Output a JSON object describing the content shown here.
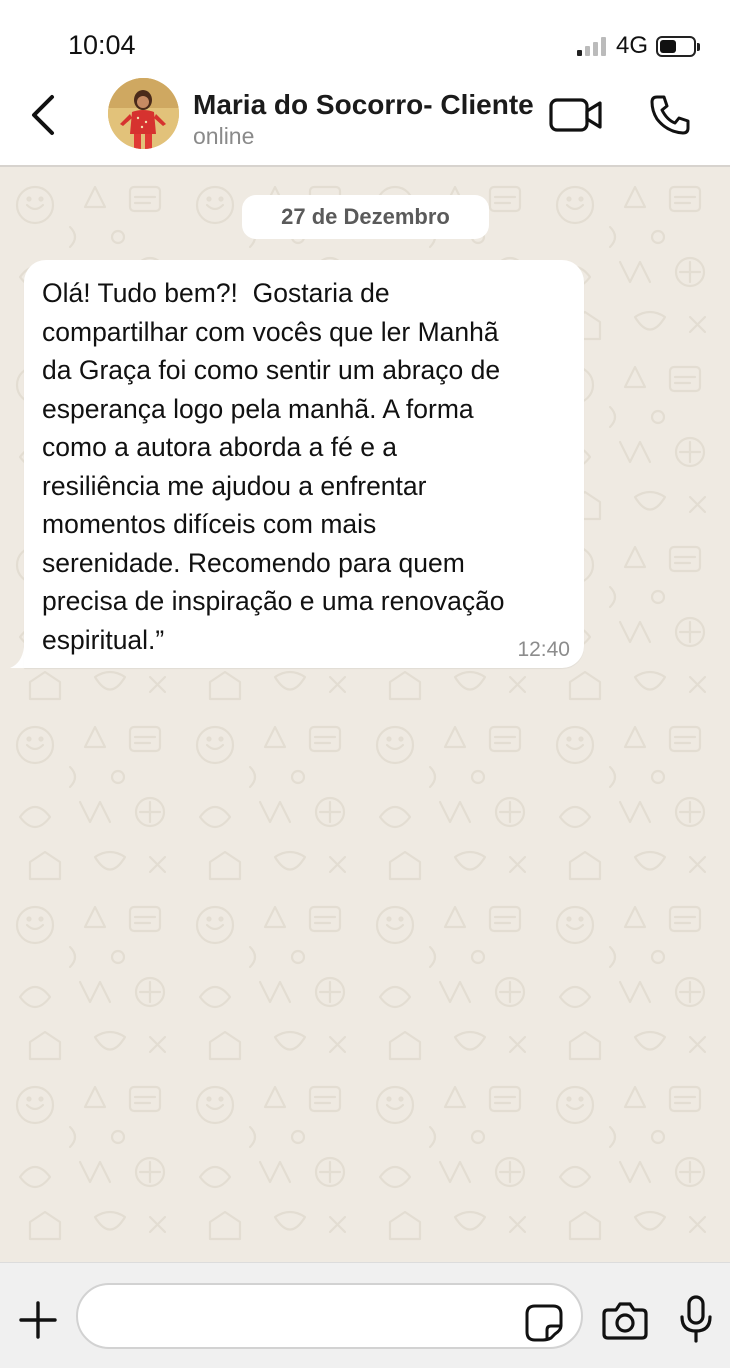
{
  "status_bar": {
    "time": "10:04",
    "network": "4G",
    "signal_bars_active": 1,
    "signal_bars_total": 4,
    "battery_level": 0.45
  },
  "header": {
    "back_icon": "chevron-left-icon",
    "contact_name": "Maria do Socorro- Cliente",
    "contact_status": "online",
    "video_icon": "video-camera-icon",
    "call_icon": "phone-icon"
  },
  "chat": {
    "date_separator": "27 de Dezembro",
    "messages": [
      {
        "direction": "incoming",
        "text": "Olá! Tudo bem?!  Gostaria de\ncompartilhar com vocês que ler Manhã\nda Graça foi como sentir um abraço de\nesperança logo pela manhã. A forma\ncomo a autora aborda a fé e a\nresiliência me ajudou a enfrentar\nmomentos difíceis com mais\nserenidade. Recomendo para quem\nprecisa de inspiração e uma renovação\nespiritual.”",
        "time": "12:40"
      }
    ]
  },
  "input_bar": {
    "plus_icon": "plus-icon",
    "input_value": "",
    "input_placeholder": "",
    "sticker_icon": "sticker-icon",
    "camera_icon": "camera-icon",
    "mic_icon": "microphone-icon"
  },
  "colors": {
    "chat_background": "#efeae2",
    "bubble_incoming": "#ffffff",
    "header_background": "#ffffff",
    "input_bar_background": "#f0f0f0",
    "secondary_text": "#8a8a8a"
  }
}
